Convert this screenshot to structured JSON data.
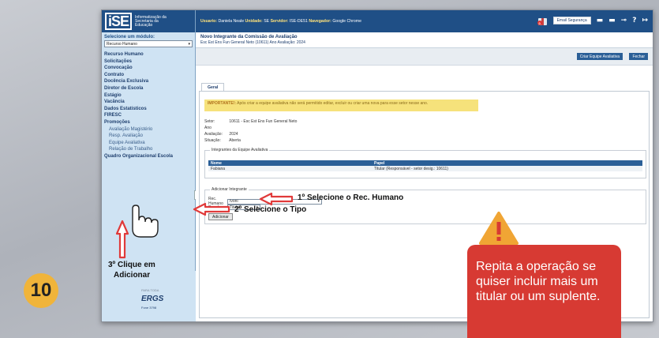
{
  "sidebar": {
    "logo_text": "iSE",
    "logo_subtitle": "Informatização da Secretaria da Educação",
    "module_label": "Selecione um módulo:",
    "module_value": "Recurso Humano",
    "items": [
      {
        "label": "Recurso Humano",
        "sub": false
      },
      {
        "label": "Solicitações",
        "sub": false
      },
      {
        "label": "Convocação",
        "sub": false
      },
      {
        "label": "Contrato",
        "sub": false
      },
      {
        "label": "Docência Exclusiva",
        "sub": false
      },
      {
        "label": "Diretor de Escola",
        "sub": false
      },
      {
        "label": "Estágio",
        "sub": false
      },
      {
        "label": "Vacância",
        "sub": false
      },
      {
        "label": "Dados Estatísticos",
        "sub": false
      },
      {
        "label": "FIRESC",
        "sub": false
      },
      {
        "label": "Promoções",
        "sub": false
      },
      {
        "label": "Avaliação Magistério",
        "sub": true
      },
      {
        "label": "Resp. Avaliação",
        "sub": true
      },
      {
        "label": "Equipe Avaliativa",
        "sub": true
      },
      {
        "label": "Relação de Trabalho",
        "sub": true
      },
      {
        "label": "Quadro Organizacional Escola",
        "sub": false
      }
    ],
    "footer_text": "PARA TODA",
    "footer_brand": "ERGS",
    "footer_phone": "Fone 3798"
  },
  "topbar": {
    "usuario_label": "Usuario:",
    "usuario_value": "Daniela Neale",
    "unidade_label": "Unidade:",
    "unidade_value": "SE",
    "servidor_label": "Servidor:",
    "servidor_value": "ISE-DE51",
    "navegador_label": "Navegador:",
    "navegador_value": "Google Chrome",
    "gift_badge": "0",
    "email_button": "Email Segurança"
  },
  "page": {
    "title": "Novo Integrante da Comissão de Avaliação",
    "subtitle": "Esc Est Ens Fun General Neto (10611) Ano Avaliação: 2024",
    "btn_create": "Criar Equipe Avaliativa",
    "btn_close": "Fechar",
    "tab": "Geral",
    "warning_bold": "IMPORTANTE!:",
    "warning_text": "Após criar a equipe avaliativa não será permitido editar, excluir ou criar uma nova para esse setor nesse ano.",
    "setor_label": "Setor:",
    "setor_value": "10611 - Esc Est Ens Fun General Neto",
    "ano_label": "Ano Avaliação:",
    "ano_value": "2024",
    "situacao_label": "Situação:",
    "situacao_value": "Aberta",
    "team_legend": "Integrantes da Equipe Avaliativa",
    "table_headers": [
      "Nome",
      "Papel"
    ],
    "table_rows": [
      [
        "Fabiana",
        "Titular (Responsável - setor desig.: 10611)"
      ]
    ],
    "add_legend": "Adicionar Integrante",
    "rh_label": "Rec. Humano",
    "rh_value": "Ivoni",
    "papel_label": "Papel",
    "papel_value": "Titular",
    "add_button": "Adicionar"
  },
  "annotations": {
    "step1": "1º Selecione o Rec. Humano",
    "step2": "2º Selecione o Tipo",
    "step3_line1": "3º Clique em",
    "step3_line2": "Adicionar",
    "step_number": "10",
    "callout": "Repita a operação se quiser incluir mais um titular ou um suplente."
  },
  "colors": {
    "topbar": "#1f4f86",
    "sidebar": "#cfe3f3",
    "warning_bg": "#f6e27b",
    "arrow_red": "#e03a3a",
    "callout_red": "#d73a33",
    "alert_triangle": "#f0a534",
    "step_badge": "#f0b43a"
  }
}
